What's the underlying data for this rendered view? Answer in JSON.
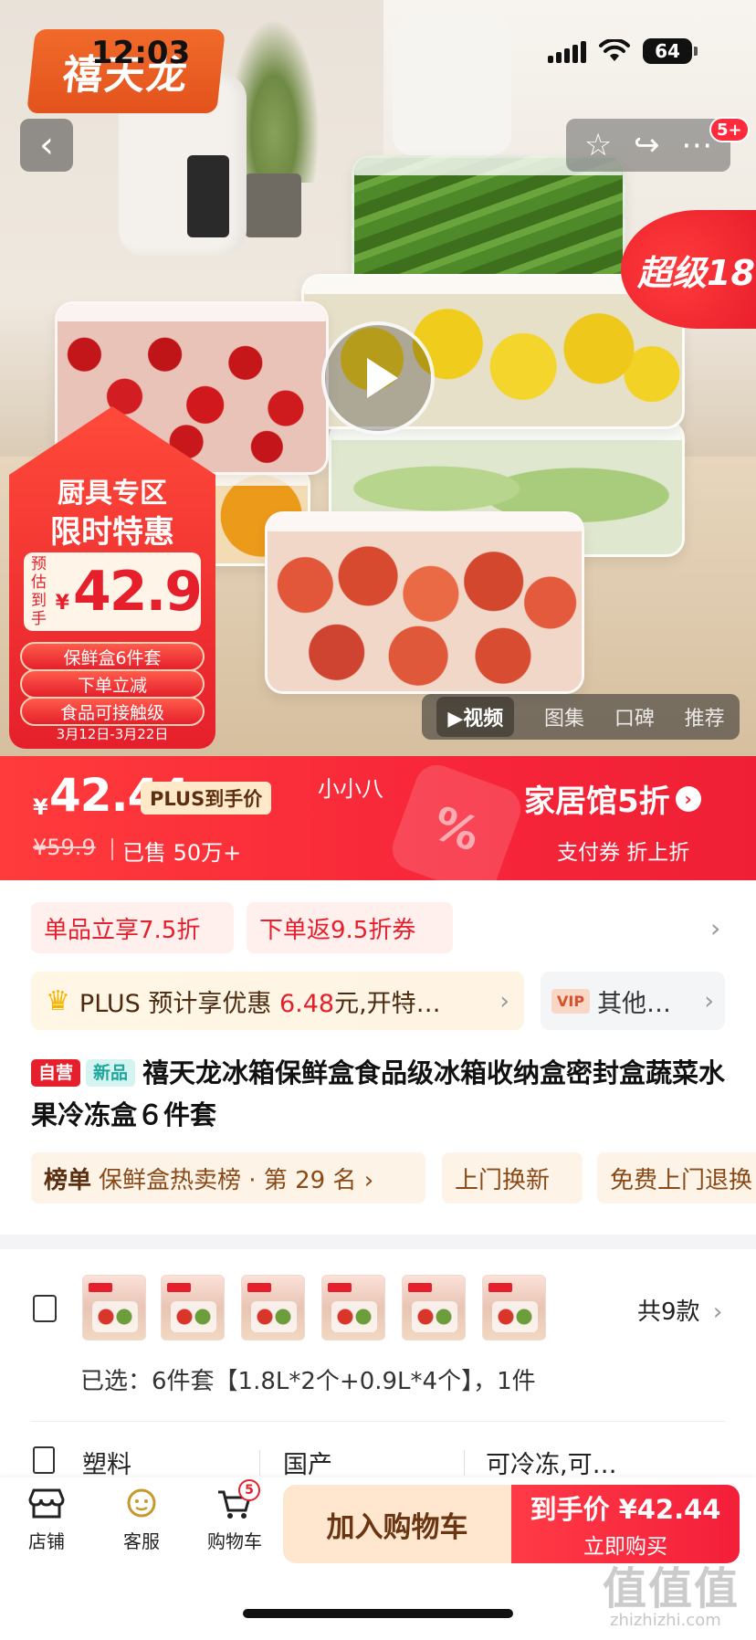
{
  "status_bar": {
    "time": "12:03",
    "battery": "64"
  },
  "hero": {
    "brand_logo": "禧天龙",
    "super_tag": "超级18",
    "notification_count": "5+",
    "promo": {
      "line1": "厨具专区",
      "line2": "限时特惠",
      "estimate_label": "预估到手",
      "currency": "¥",
      "price": "42.9",
      "pills": [
        "保鲜盒6件套",
        "下单立减",
        "食品可接触级"
      ],
      "date_range": "3月12日-3月22日"
    },
    "media_tabs": [
      {
        "label": "▶视频",
        "active": true
      },
      {
        "label": "图集",
        "active": false
      },
      {
        "label": "口碑",
        "active": false
      },
      {
        "label": "推荐",
        "active": false
      }
    ]
  },
  "price_banner": {
    "currency": "¥",
    "price": "42.44",
    "plus_tag": "PLUS到手价",
    "original_price": "¥59.9",
    "sold": "已售 50万+",
    "nickname": "小小八",
    "promo_title": "家居馆5折",
    "promo_sub": "支付券 折上折",
    "percent_icon": "%"
  },
  "coupons": [
    "单品立享7.5折",
    "下单返9.5折券"
  ],
  "plus_row": {
    "prefix": "PLUS 预计享优惠 ",
    "amount": "6.48",
    "suffix": "元,开特…"
  },
  "vip_row": {
    "badge": "VIP",
    "label": "其他…"
  },
  "title": {
    "tag_self": "自营",
    "tag_new": "新品",
    "text": "禧天龙冰箱保鲜盒食品级冰箱收纳盒密封盒蔬菜水果冷冻盒６件套"
  },
  "rank_row": [
    {
      "bold": "榜单",
      "text": "保鲜盒热卖榜 · 第 29 名 ›"
    },
    {
      "bold": "",
      "text": "上门换新"
    },
    {
      "bold": "",
      "text": "免费上门退换"
    }
  ],
  "sku": {
    "count": "共9款",
    "selected": "已选：6件套【1.8L*2个+0.9L*4个】，1件"
  },
  "specs": [
    "塑料",
    "国产",
    "可冷冻,可…"
  ],
  "bottom_nav": {
    "shop": "店铺",
    "service": "客服",
    "cart": "购物车",
    "cart_count": "5",
    "add_to_cart": "加入购物车",
    "buy_price": "到手价 ¥42.44",
    "buy_now": "立即购买"
  },
  "watermark": {
    "main": "值值值",
    "sub": "zhizhizhi.com"
  }
}
